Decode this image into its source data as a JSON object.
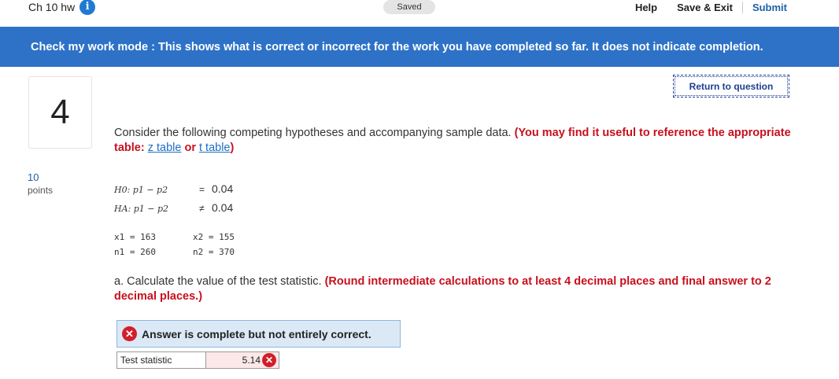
{
  "header": {
    "assignment_title": "Ch 10 hw",
    "info_icon": "i",
    "saved_status": "Saved",
    "help_label": "Help",
    "save_exit_label": "Save & Exit",
    "submit_label": "Submit"
  },
  "banner": {
    "text": "Check my work mode : This shows what is correct or incorrect for the work you have completed so far. It does not indicate completion."
  },
  "question": {
    "number": "4",
    "points_value": "10",
    "points_label": "points",
    "return_label": "Return to question",
    "prompt": "Consider the following competing hypotheses and accompanying sample data.",
    "reference_prefix": "(You may find it useful to reference the appropriate table:",
    "z_table_link": "z table",
    "or_text": "or",
    "t_table_link": "t table",
    "reference_suffix": ")",
    "hypotheses": [
      {
        "lhs": "H0: p1 − p2",
        "op": "=",
        "value": "0.04"
      },
      {
        "lhs": "HA: p1 − p2",
        "op": "≠",
        "value": "0.04"
      }
    ],
    "sample": {
      "x1": "x1 = 163",
      "n1": "n1 = 260",
      "x2": "x2 = 155",
      "n2": "n2 = 370"
    },
    "part_a_text": "a. Calculate the value of the test statistic.",
    "part_a_instructions": "(Round intermediate calculations to at least 4 decimal places and final answer to 2 decimal places.)",
    "result_message": "Answer is complete but not entirely correct.",
    "answer_label": "Test statistic",
    "answer_value": "5.14"
  },
  "colors": {
    "banner": "#2e72c7",
    "error_red": "#c8101e",
    "link_blue": "#1f6fc4",
    "result_bg": "#dbe9f6",
    "answer_incorrect_bg": "#fde8e8"
  },
  "icons": {
    "info": "info-icon",
    "incorrect": "x-circle-icon"
  }
}
